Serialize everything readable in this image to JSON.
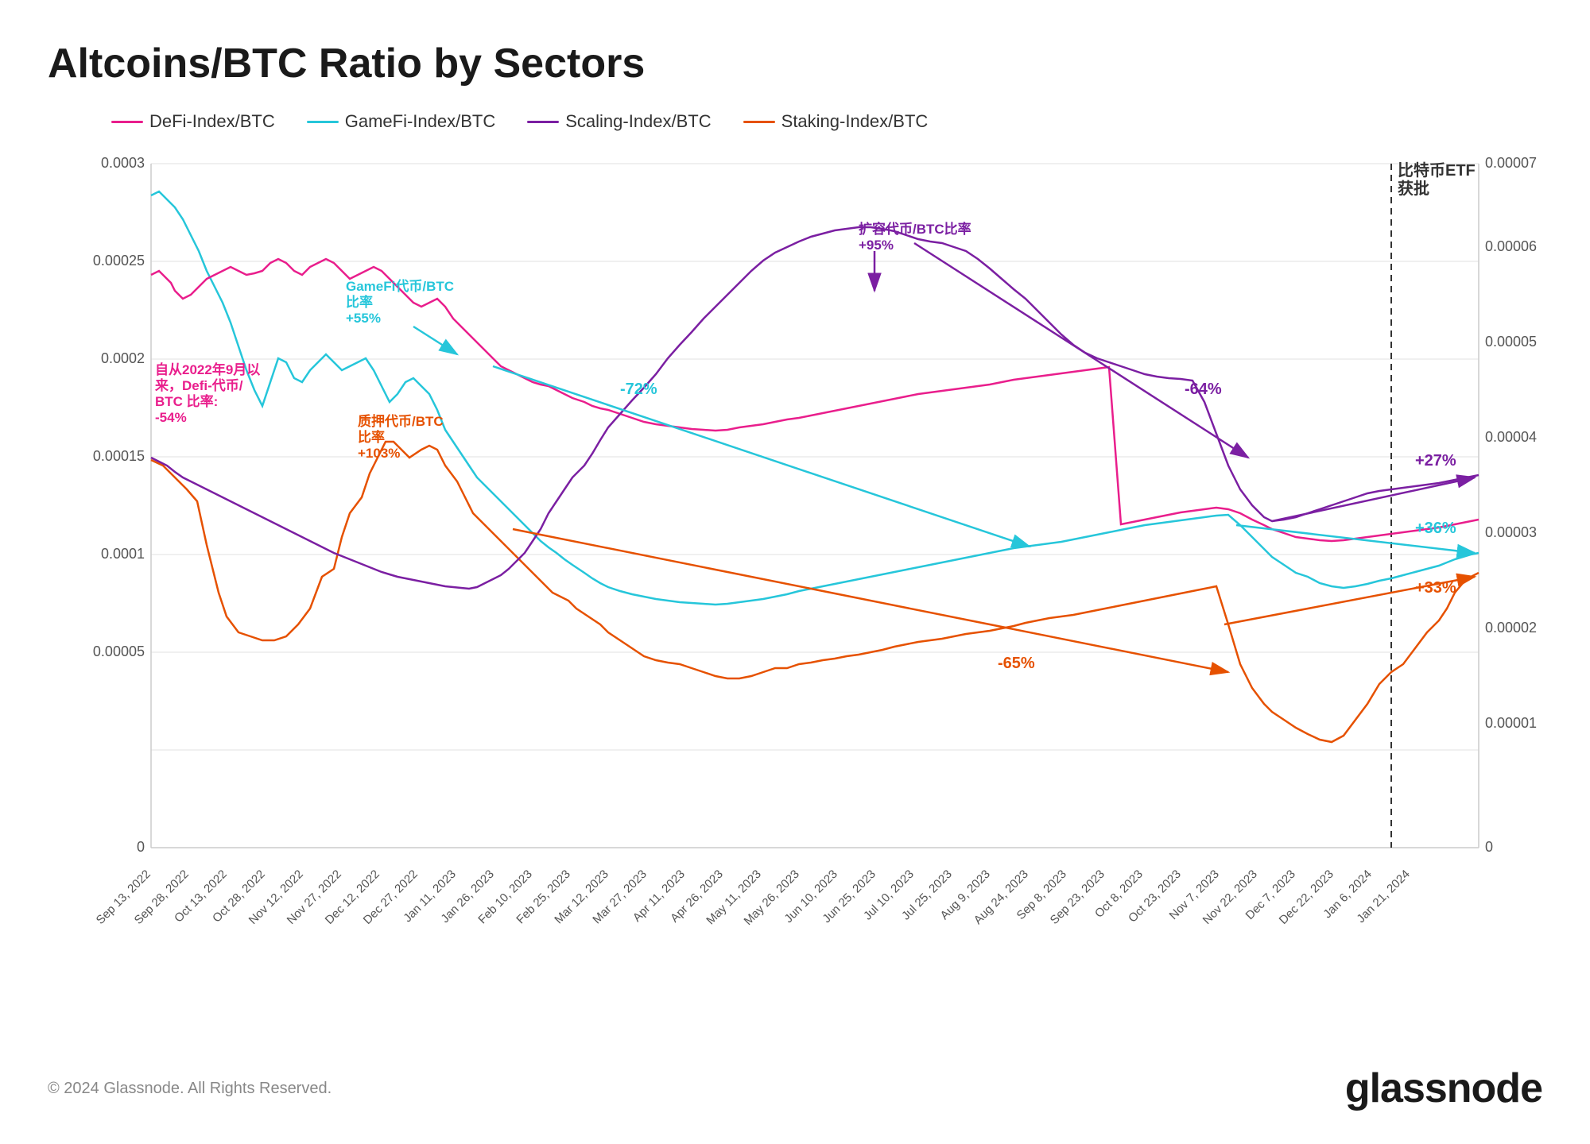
{
  "title": "Altcoins/BTC Ratio by Sectors",
  "legend": {
    "items": [
      {
        "label": "DeFi-Index/BTC",
        "color": "#e91e8c"
      },
      {
        "label": "GameFi-Index/BTC",
        "color": "#26c6da"
      },
      {
        "label": "Scaling-Index/BTC",
        "color": "#7b1fa2"
      },
      {
        "label": "Staking-Index/BTC",
        "color": "#e65100"
      }
    ]
  },
  "annotations": {
    "defi": {
      "text": "自从2022年9月以\n来，Defi-代币/\nBTC 比率:\n-54%",
      "color": "#e91e8c"
    },
    "gamefi": {
      "text": "GameFi代币/BTC\n比率\n+55%",
      "color": "#26c6da"
    },
    "staking": {
      "text": "质押代币/BTC\n比率\n+103%",
      "color": "#e65100"
    },
    "scaling1": {
      "text": "-72%",
      "color": "#26c6da"
    },
    "scaling2": {
      "text": "扩容代币/BTC比率\n+95%",
      "color": "#7b1fa2"
    },
    "scaling3": {
      "text": "-64%",
      "color": "#7b1fa2"
    },
    "scaling4": {
      "text": "-65%",
      "color": "#e65100"
    },
    "recent1": {
      "text": "+27%",
      "color": "#7b1fa2"
    },
    "recent2": {
      "text": "+36%",
      "color": "#26c6da"
    },
    "recent3": {
      "text": "+33%",
      "color": "#e65100"
    },
    "btcetf": {
      "text": "比特币ETF\n获批",
      "color": "#333"
    }
  },
  "yaxis_left": {
    "values": [
      "0.0003",
      "0.00025",
      "0.0002",
      "0.00015",
      "0.0001",
      "0.00005",
      "0"
    ]
  },
  "yaxis_right": {
    "values": [
      "0.00007",
      "0.00006",
      "0.00005",
      "0.00004",
      "0.00003",
      "0.00002",
      "0.00001",
      "0"
    ]
  },
  "xaxis": {
    "labels": [
      "Sep 13, 2022",
      "Sep 28, 2022",
      "Oct 13, 2022",
      "Oct 28, 2022",
      "Nov 12, 2022",
      "Nov 27, 2022",
      "Dec 12, 2022",
      "Dec 27, 2022",
      "Jan 11, 2023",
      "Jan 26, 2023",
      "Feb 10, 2023",
      "Feb 25, 2023",
      "Mar 12, 2023",
      "Mar 27, 2023",
      "Apr 11, 2023",
      "Apr 26, 2023",
      "May 11, 2023",
      "May 26, 2023",
      "Jun 10, 2023",
      "Jun 25, 2023",
      "Jul 10, 2023",
      "Jul 25, 2023",
      "Aug 9, 2023",
      "Aug 24, 2023",
      "Sep 8, 2023",
      "Sep 23, 2023",
      "Oct 8, 2023",
      "Oct 23, 2023",
      "Nov 7, 2023",
      "Nov 22, 2023",
      "Dec 7, 2023",
      "Dec 22, 2023",
      "Jan 6, 2024",
      "Jan 21, 2024"
    ]
  },
  "footer": {
    "copyright": "© 2024 Glassnode. All Rights Reserved.",
    "brand": "glassnode"
  },
  "colors": {
    "defi": "#e91e8c",
    "gamefi": "#26c6da",
    "scaling": "#7b1fa2",
    "staking": "#e65100",
    "grid": "#e0e0e0",
    "axis": "#999"
  }
}
